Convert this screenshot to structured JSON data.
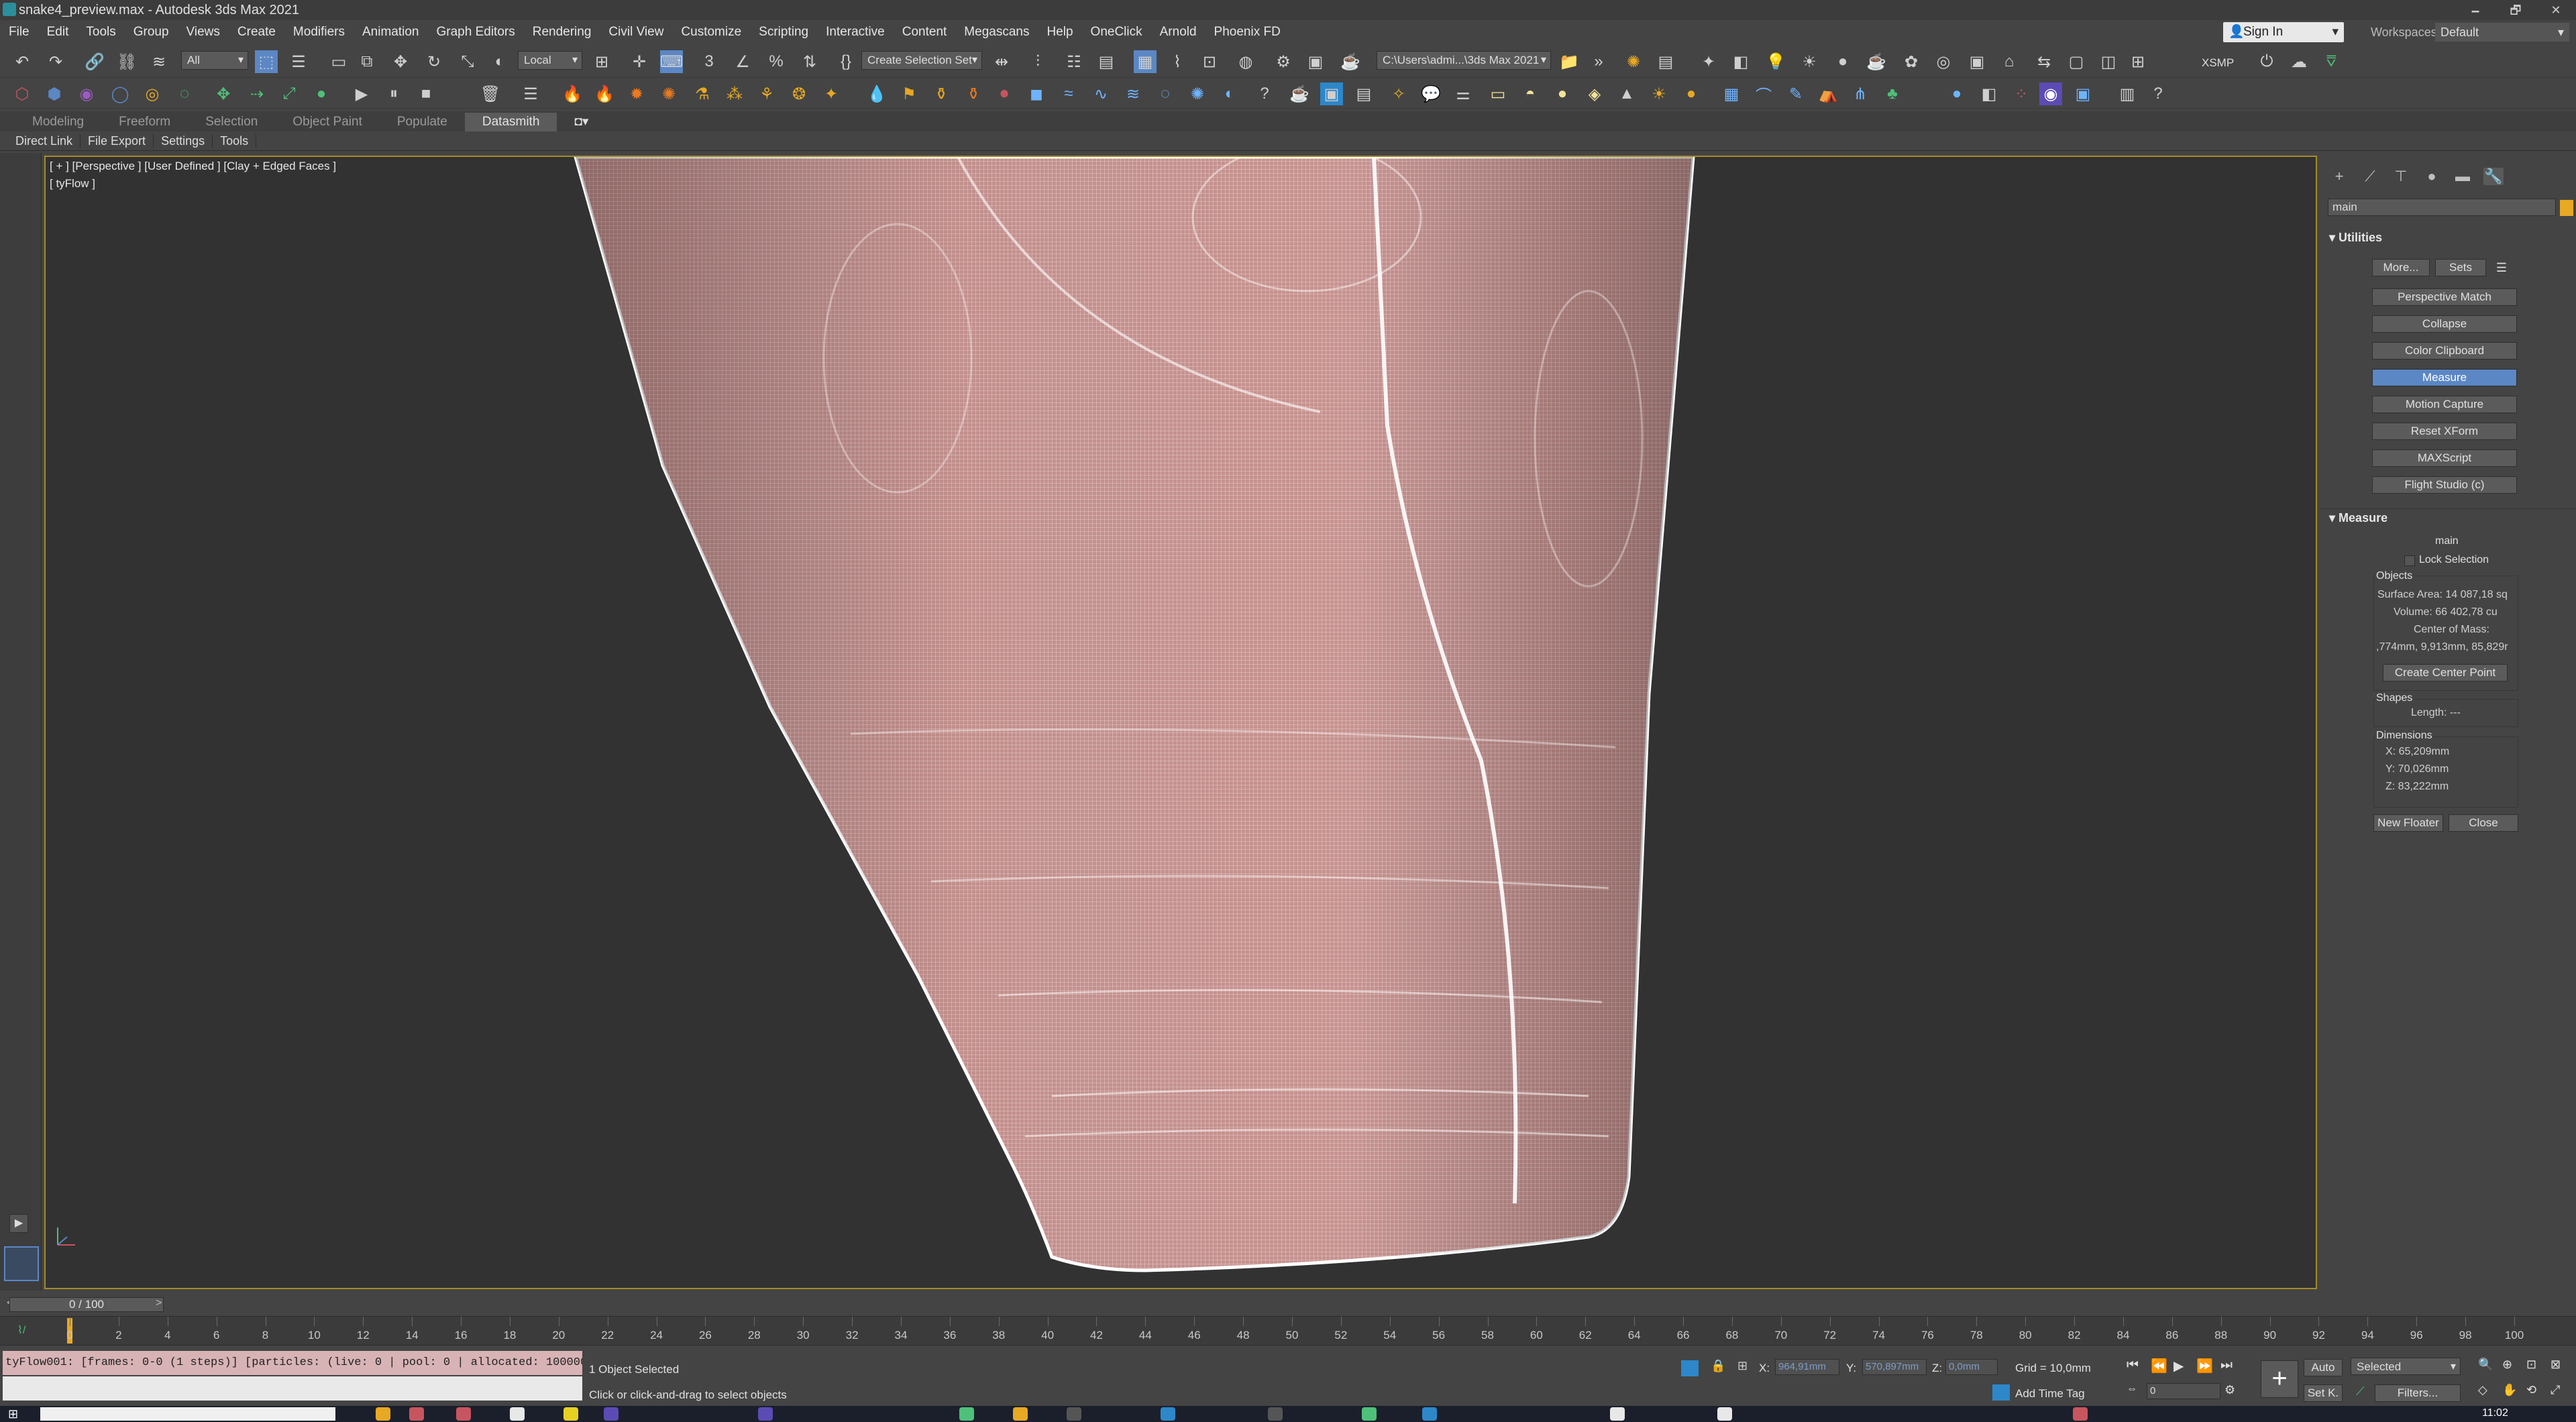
{
  "window": {
    "title": "snake4_preview.max - Autodesk 3ds Max 2021",
    "controls": [
      "🗕",
      "🗗",
      "✕"
    ]
  },
  "menu": [
    "File",
    "Edit",
    "Tools",
    "Group",
    "Views",
    "Create",
    "Modifiers",
    "Animation",
    "Graph Editors",
    "Rendering",
    "Civil View",
    "Customize",
    "Scripting",
    "Interactive",
    "Content",
    "Megascans",
    "Help",
    "OneClick",
    "Arnold",
    "Phoenix FD"
  ],
  "account": {
    "sign_in": "Sign In",
    "workspaces_label": "Workspaces:",
    "workspace": "Default"
  },
  "toolbar": {
    "filter": "All",
    "ref_coord": "Local",
    "selection_set": "Create Selection Set",
    "project_path": "C:\\Users\\admi...\\3ds Max 2021",
    "xsmp": "XSMP",
    "icons": [
      "undo-icon",
      "redo-icon",
      "link-icon",
      "unlink-icon",
      "bind-spacewarp-icon",
      "select-object-icon",
      "select-by-name-icon",
      "rect-region-icon",
      "window-crossing-icon",
      "move-icon",
      "rotate-icon",
      "scale-icon",
      "place-icon"
    ]
  },
  "ribbon": {
    "tabs": [
      "Modeling",
      "Freeform",
      "Selection",
      "Object Paint",
      "Populate",
      "Datasmith"
    ],
    "active": "Datasmith",
    "subtabs": [
      "Direct Link",
      "File Export",
      "Settings",
      "Tools"
    ]
  },
  "viewport": {
    "label": "[ + ] [Perspective ] [User Defined ] [Clay + Edged Faces ]",
    "sublabel": "[ tyFlow ]",
    "mesh_color": "#c9908f",
    "wire_color": "#ffffff"
  },
  "command_panel": {
    "search": "main",
    "utilities_title": "Utilities",
    "more": "More...",
    "sets": "Sets",
    "buttons": [
      "Perspective Match",
      "Collapse",
      "Color Clipboard",
      "Measure",
      "Motion Capture",
      "Reset XForm",
      "MAXScript",
      "Flight Studio (c)"
    ],
    "active_button": "Measure",
    "measure": {
      "title": "Measure",
      "object_name": "main",
      "lock_selection": "Lock Selection",
      "objects_label": "Objects",
      "surface_area": "Surface Area: 14 087,18 sq",
      "volume": "Volume: 66 402,78 cu",
      "center_of_mass": "Center of Mass:",
      "com_value": ",774mm, 9,913mm, 85,829r",
      "create_center": "Create Center Point",
      "shapes_label": "Shapes",
      "length": "Length: ---",
      "dimensions_label": "Dimensions",
      "dim_x": "X: 65,209mm",
      "dim_y": "Y: 70,026mm",
      "dim_z": "Z: 83,222mm",
      "new_floater": "New Floater",
      "close": "Close"
    }
  },
  "timeline": {
    "slider": "0 / 100",
    "ticks": [
      0,
      2,
      4,
      6,
      8,
      10,
      12,
      14,
      16,
      18,
      20,
      22,
      24,
      26,
      28,
      30,
      32,
      34,
      36,
      38,
      40,
      42,
      44,
      46,
      48,
      50,
      52,
      54,
      56,
      58,
      60,
      62,
      64,
      66,
      68,
      70,
      72,
      74,
      76,
      78,
      80,
      82,
      84,
      86,
      88,
      90,
      92,
      94,
      96,
      98,
      100
    ]
  },
  "status": {
    "maxscript": "tyFlow001: [frames: 0-0 (1 steps)] [particles: (live: 0 | pool: 0 | allocated: 100000",
    "selection": "1 Object Selected",
    "prompt": "Click or click-and-drag to select objects",
    "x_label": "X:",
    "x_val": "964,91mm",
    "y_label": "Y:",
    "y_val": "570,897mm",
    "z_label": "Z:",
    "z_val": "0,0mm",
    "grid": "Grid = 10,0mm",
    "add_time_tag": "Add Time Tag",
    "frame": "0",
    "auto": "Auto",
    "set_key": "Set K.",
    "key_filter": "Selected",
    "filters": "Filters...",
    "clock": "11:02"
  }
}
